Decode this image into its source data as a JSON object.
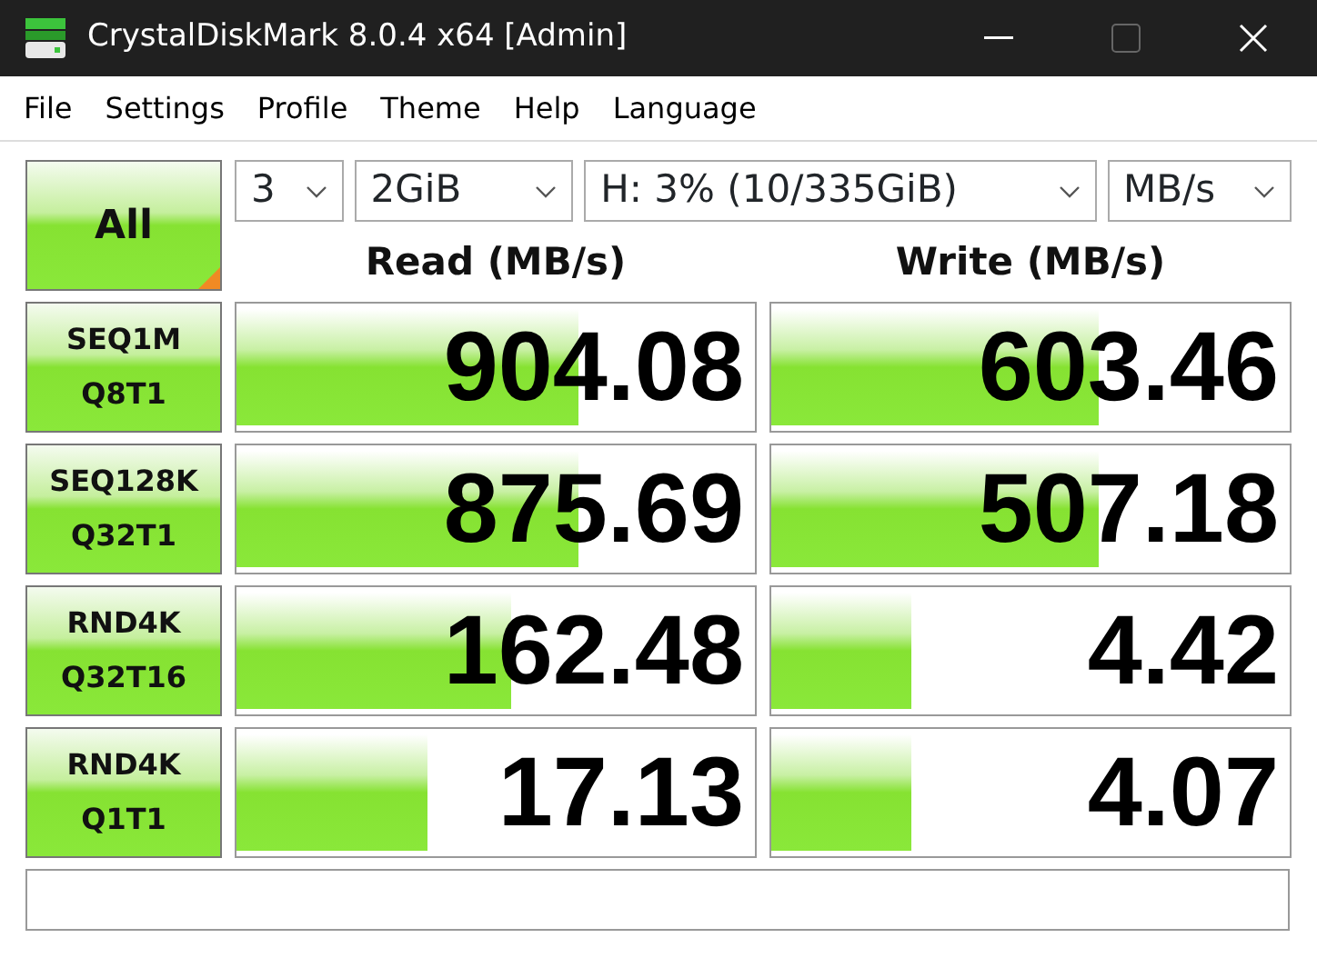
{
  "window": {
    "title": "CrystalDiskMark 8.0.4 x64 [Admin]"
  },
  "menu": [
    "File",
    "Settings",
    "Profile",
    "Theme",
    "Help",
    "Language"
  ],
  "all_button": {
    "label": "All"
  },
  "dropdowns": [
    {
      "value": "3"
    },
    {
      "value": "2GiB"
    },
    {
      "value": "H: 3% (10/335GiB)"
    },
    {
      "value": "MB/s"
    }
  ],
  "columns": [
    "Read (MB/s)",
    "Write (MB/s)"
  ],
  "tests": [
    {
      "label": [
        "SEQ1M",
        "Q8T1"
      ],
      "read": {
        "value": "904.08",
        "level": 0.66
      },
      "write": {
        "value": "603.46",
        "level": 0.63
      }
    },
    {
      "label": [
        "SEQ128K",
        "Q32T1"
      ],
      "read": {
        "value": "875.69",
        "level": 0.66
      },
      "write": {
        "value": "507.18",
        "level": 0.63
      }
    },
    {
      "label": [
        "RND4K",
        "Q32T16"
      ],
      "read": {
        "value": "162.48",
        "level": 0.53
      },
      "write": {
        "value": "4.42",
        "level": 0.27
      }
    },
    {
      "label": [
        "RND4K",
        "Q1T1"
      ],
      "read": {
        "value": "17.13",
        "level": 0.37
      },
      "write": {
        "value": "4.07",
        "level": 0.27
      }
    }
  ]
}
